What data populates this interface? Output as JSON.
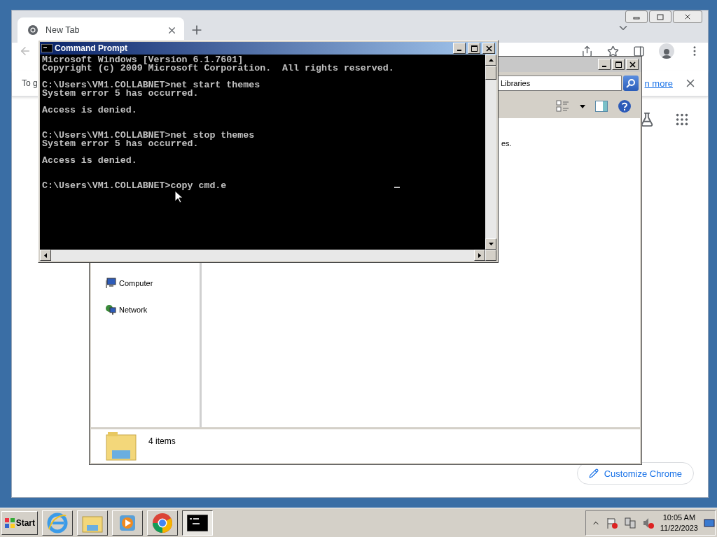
{
  "chrome": {
    "tabs": [
      {
        "title": "New Tab",
        "selected": true
      }
    ],
    "infobar": {
      "text": "To g",
      "link": "n more"
    },
    "customize_button": "Customize Chrome"
  },
  "explorer": {
    "address": "Libraries",
    "content_text": "es.",
    "nav_items": [
      {
        "label": "Computer",
        "kind": "computer"
      },
      {
        "label": "Network",
        "kind": "network"
      }
    ],
    "status": "4 items"
  },
  "console": {
    "title": "Command Prompt",
    "output": "Microsoft Windows [Version 6.1.7601]\nCopyright (c) 2009 Microsoft Corporation.  All rights reserved.\n\nC:\\Users\\VM1.COLLABNET>net start themes\nSystem error 5 has occurred.\n\nAccess is denied.\n\n\nC:\\Users\\VM1.COLLABNET>net stop themes\nSystem error 5 has occurred.\n\nAccess is denied.\n\n\nC:\\Users\\VM1.COLLABNET>copy cmd.e"
  },
  "taskbar": {
    "start": "Start",
    "apps": [
      {
        "kind": "ie",
        "selected": false
      },
      {
        "kind": "explorer",
        "selected": false
      },
      {
        "kind": "media",
        "selected": false
      },
      {
        "kind": "chrome",
        "selected": false
      },
      {
        "kind": "cmd",
        "selected": true
      }
    ],
    "time": "10:05 AM",
    "date": "11/22/2023"
  }
}
